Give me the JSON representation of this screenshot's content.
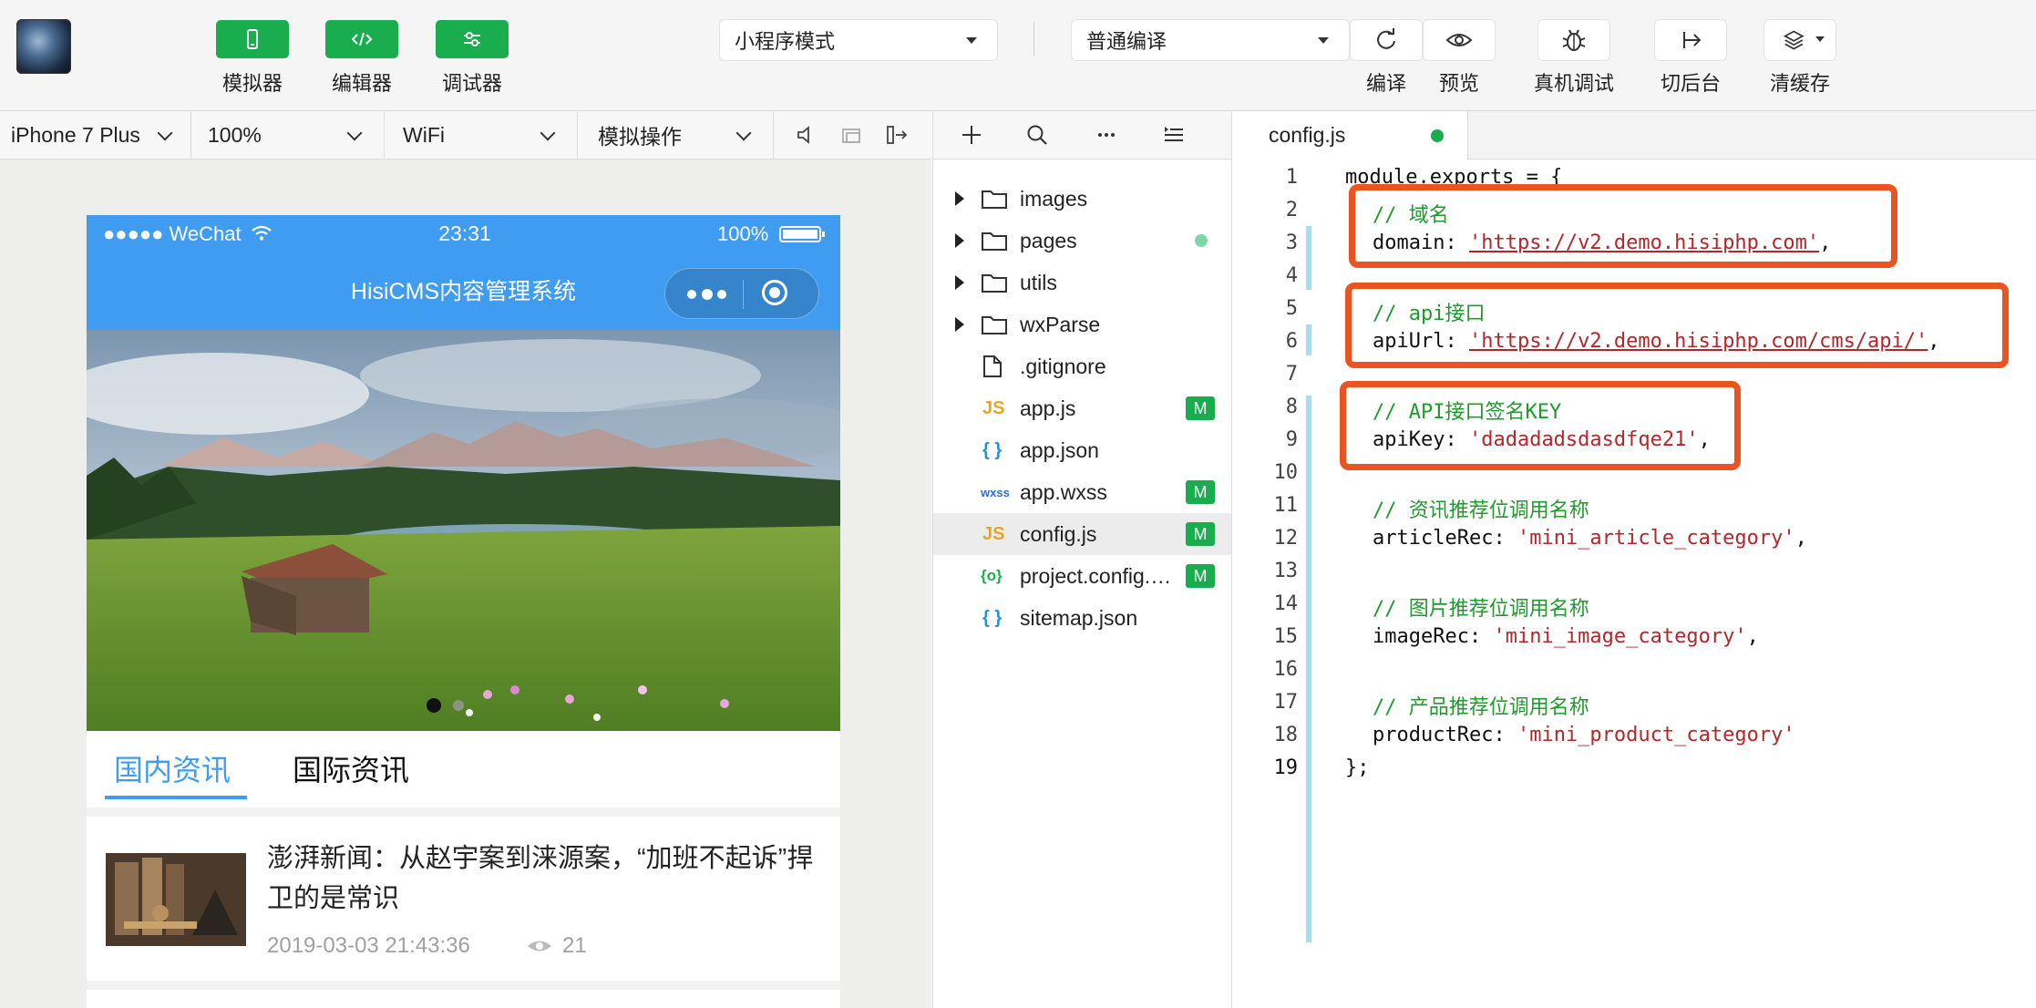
{
  "toolbar": {
    "simulator_label": "模拟器",
    "editor_label": "编辑器",
    "debugger_label": "调试器",
    "mode_select": "小程序模式",
    "compile_select": "普通编译",
    "compile_label": "编译",
    "preview_label": "预览",
    "real_debug_label": "真机调试",
    "background_label": "切后台",
    "clear_cache_label": "清缓存"
  },
  "simulator_bar": {
    "device": "iPhone 7 Plus",
    "zoom": "100%",
    "network": "WiFi",
    "operation": "模拟操作"
  },
  "phone": {
    "carrier": "●●●●● WeChat",
    "time": "23:31",
    "battery": "100%",
    "nav_title": "HisiCMS内容管理系统",
    "tabs": [
      "国内资讯",
      "国际资讯"
    ],
    "article": {
      "title": "澎湃新闻：从赵宇案到涞源案，“加班不起诉”捍卫的是常识",
      "date": "2019-03-03 21:43:36",
      "views": "21"
    }
  },
  "explorer": {
    "files": [
      {
        "name": "images",
        "type": "folder"
      },
      {
        "name": "pages",
        "type": "folder"
      },
      {
        "name": "utils",
        "type": "folder"
      },
      {
        "name": "wxParse",
        "type": "folder"
      },
      {
        "name": ".gitignore",
        "type": "file",
        "icon": ""
      },
      {
        "name": "app.js",
        "type": "file",
        "icon": "JS",
        "badge": "M"
      },
      {
        "name": "app.json",
        "type": "file",
        "icon": "{ }"
      },
      {
        "name": "app.wxss",
        "type": "file",
        "icon": "wxss",
        "badge": "M"
      },
      {
        "name": "config.js",
        "type": "file",
        "icon": "JS",
        "badge": "M"
      },
      {
        "name": "project.config.…",
        "type": "file",
        "icon": "{o}",
        "badge": "M"
      },
      {
        "name": "sitemap.json",
        "type": "file",
        "icon": "{ }"
      }
    ]
  },
  "editor": {
    "tab": "config.js",
    "lines": [
      {
        "n": "1",
        "t": "module.exports = {"
      },
      {
        "n": "2",
        "c": "// 域名"
      },
      {
        "n": "3",
        "k": "domain: ",
        "s": "'https://v2.demo.hisiphp.com'",
        "e": ","
      },
      {
        "n": "4",
        "t": ""
      },
      {
        "n": "5",
        "c": "// api接口"
      },
      {
        "n": "6",
        "k": "apiUrl: ",
        "s": "'https://v2.demo.hisiphp.com/cms/api/'",
        "e": ","
      },
      {
        "n": "7",
        "t": ""
      },
      {
        "n": "8",
        "c": "// API接口签名KEY"
      },
      {
        "n": "9",
        "k": "apiKey: ",
        "s": "'dadadadsdasdfqe21'",
        "e": ","
      },
      {
        "n": "10",
        "t": ""
      },
      {
        "n": "11",
        "c": "// 资讯推荐位调用名称"
      },
      {
        "n": "12",
        "k": "articleRec: ",
        "s": "'mini_article_category'",
        "e": ","
      },
      {
        "n": "13",
        "t": ""
      },
      {
        "n": "14",
        "c": "// 图片推荐位调用名称"
      },
      {
        "n": "15",
        "k": "imageRec: ",
        "s": "'mini_image_category'",
        "e": ","
      },
      {
        "n": "16",
        "t": ""
      },
      {
        "n": "17",
        "c": "// 产品推荐位调用名称"
      },
      {
        "n": "18",
        "k": "productRec: ",
        "s": "'mini_product_category'",
        "e": ""
      },
      {
        "n": "19",
        "t": "};"
      }
    ]
  },
  "colors": {
    "accent_green": "#1aad4e",
    "wechat_blue": "#3f9cf0",
    "highlight_box": "#e95420"
  }
}
